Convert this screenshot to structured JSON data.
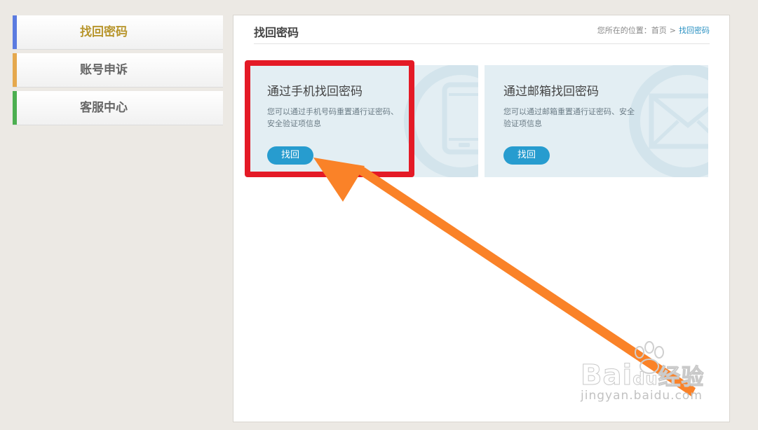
{
  "sidebar": {
    "items": [
      {
        "label": "找回密码",
        "color": "#5b7be0",
        "active": true
      },
      {
        "label": "账号申诉",
        "color": "#e5a84d",
        "active": false
      },
      {
        "label": "客服中心",
        "color": "#4caf50",
        "active": false
      }
    ]
  },
  "main": {
    "title": "找回密码",
    "breadcrumb": {
      "prefix": "您所在的位置：",
      "home": "首页",
      "separator": ">",
      "current": "找回密码"
    },
    "cards": [
      {
        "title": "通过手机找回密码",
        "description": "您可以通过手机号码重置通行证密码、安全验证项信息",
        "button_label": "找回",
        "icon": "phone-icon"
      },
      {
        "title": "通过邮箱找回密码",
        "description": "您可以通过邮箱重置通行证密码、安全验证项信息",
        "button_label": "找回",
        "icon": "envelope-icon"
      }
    ]
  },
  "annotation": {
    "highlight_color": "#e41a26",
    "arrow_color": "#fa8228"
  },
  "watermark": {
    "brand": "Bai",
    "brand_mid": "du",
    "brand_cn": "经验",
    "url": "jingyan.baidu.com"
  }
}
